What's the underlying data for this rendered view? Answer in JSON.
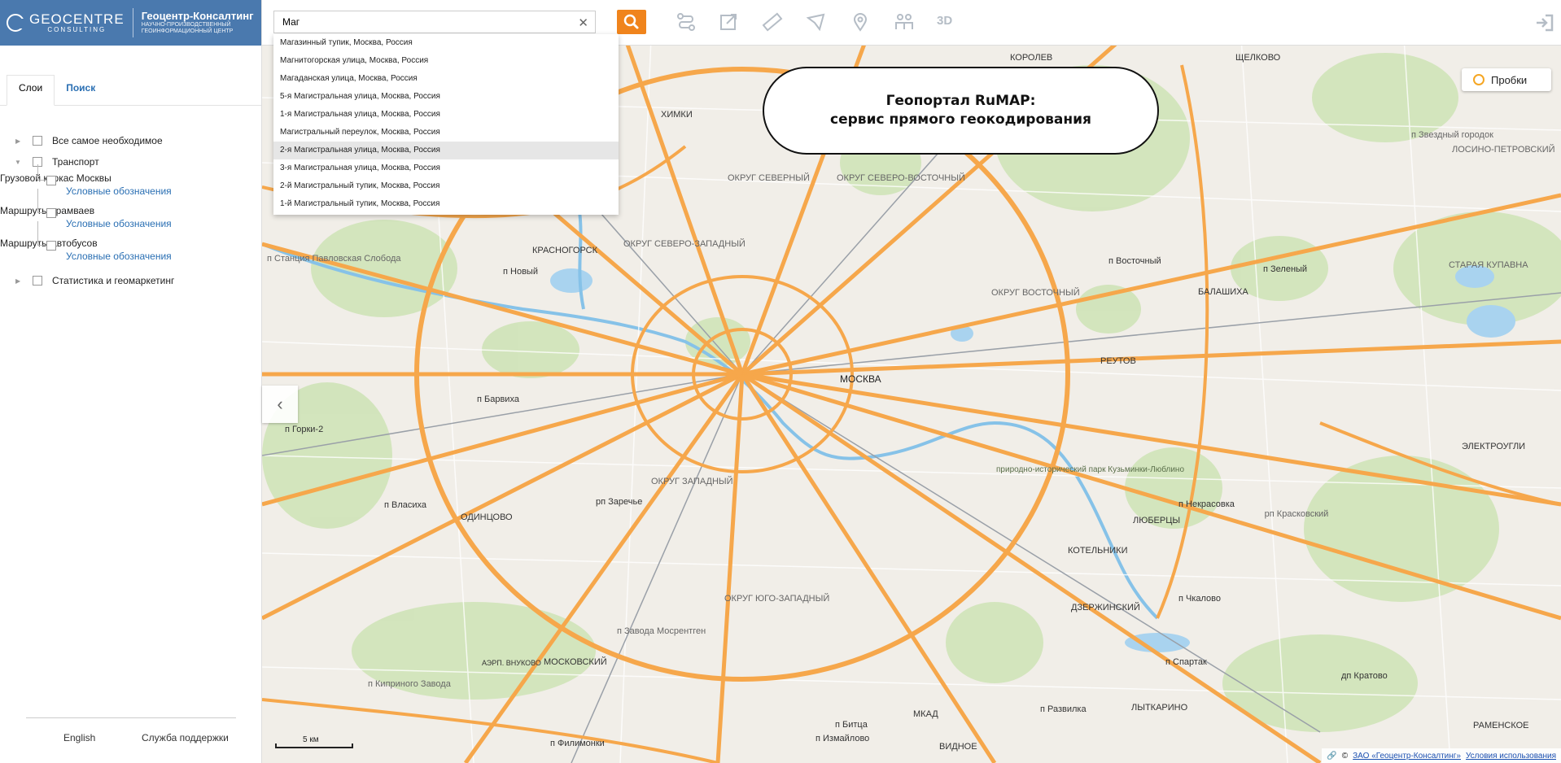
{
  "brand": {
    "logo_text": "GEOCENTRE",
    "logo_sub": "CONSULTING",
    "company": "Геоцентр-Консалтинг",
    "company_sub_1": "НАУЧНО-ПРОИЗВОДСТВЕННЫЙ",
    "company_sub_2": "ГЕОИНФОРМАЦИОННЫЙ ЦЕНТР"
  },
  "tabs": [
    {
      "label": "Слои"
    },
    {
      "label": "Поиск"
    }
  ],
  "tree": {
    "item1": "Все самое необходимое",
    "item2": "Транспорт",
    "sub1": "Грузовой каркас Москвы",
    "sub2": "Маршруты трамваев",
    "sub3": "Маршруты автобусов",
    "legend": "Условные обозначения",
    "item3": "Статистика и геомаркетинг"
  },
  "footer": {
    "english": "English",
    "support": "Служба поддержки"
  },
  "search": {
    "value": "Маг",
    "placeholder": ""
  },
  "suggestions": [
    "Магазинный тупик, Москва, Россия",
    "Магнитогорская улица, Москва, Россия",
    "Магаданская улица, Москва, Россия",
    "5-я Магистральная улица, Москва, Россия",
    "1-я Магистральная улица, Москва, Россия",
    "Магистральный переулок, Москва, Россия",
    "2-я Магистральная улица, Москва, Россия",
    "3-я Магистральная улица, Москва, Россия",
    "2-й Магистральный тупик, Москва, Россия",
    "1-й Магистральный тупик, Москва, Россия"
  ],
  "toolbar": {
    "three_d": "3D"
  },
  "callout": {
    "line1": "Геопортал RuMAP:",
    "line2": "сервис прямого геокодирования"
  },
  "traffic": "Пробки",
  "scale": "5 км",
  "attribution": {
    "prefix": "©",
    "company": "ЗАО «Геоцентр-Консалтинг»",
    "terms": "Условия использования"
  },
  "map_labels": {
    "moscow": "МОСКВА",
    "khimki": "ХИМКИ",
    "korolev": "КОРОЛЕВ",
    "shchelkovo": "ЩЕЛКОВО",
    "krasnogorsk": "КРАСНОГОРСК",
    "balashikha": "БАЛАШИХА",
    "reutov": "РЕУТОВ",
    "odintsovo": "ОДИНЦОВО",
    "lyubertsy": "ЛЮБЕРЦЫ",
    "kotelniki": "КОТЕЛЬНИКИ",
    "dzerzhinsky": "ДЗЕРЖИНСКИЙ",
    "moskovsky": "МОСКОВСКИЙ",
    "lytkarino": "ЛЫТКАРИНО",
    "vidnoe": "ВИДНОЕ",
    "elektrougli": "ЭЛЕКТРОУГЛИ",
    "ramenskoe": "РАМЕНСКОЕ",
    "staraya_kupavna": "СТАРАЯ КУПАВНА",
    "losino": "ЛОСИНО-ПЕТРОВСКИЙ",
    "vnukovo": "АЭРП. ВНУКОВО",
    "okrug_sev": "ОКРУГ СЕВЕРНЫЙ",
    "okrug_sv": "ОКРУГ СЕВЕРО-ВОСТОЧНЫЙ",
    "okrug_sz": "ОКРУГ СЕВЕРО-ЗАПАДНЫЙ",
    "okrug_v": "ОКРУГ ВОСТОЧНЫЙ",
    "okrug_z": "ОКРУГ ЗАПАДНЫЙ",
    "okrug_yuz": "ОКРУГ ЮГО-ЗАПАДНЫЙ",
    "mkad": "МКАД",
    "p_novy": "п Новый",
    "p_barvikha": "п Барвиха",
    "p_vlasikha": "п Власиха",
    "p_zarechye": "рп Заречье",
    "p_vostochny": "п Восточный",
    "p_zeleny": "п Зеленый",
    "p_nekrasovka": "п Некрасовка",
    "p_kraskovo": "рп Красковский",
    "p_chkalovo": "п Чкалово",
    "p_spartak": "п Спартак",
    "p_kratovo": "дп Кратово",
    "p_razvilka": "п Развилка",
    "p_bitsa": "п Битца",
    "p_izmailovo": "п Измайлово",
    "p_filimonki": "п Филимонки",
    "p_kiprinnogo": "п Киприного Завода",
    "p_mosrentgen": "п Завода Мосрентген",
    "p_gorki": "п Горки-2",
    "stantsiya": "п Станция Павловская Слобода",
    "zvezdny": "п Звездный городок",
    "park": "природно-исторический парк Кузьминки-Люблино"
  }
}
